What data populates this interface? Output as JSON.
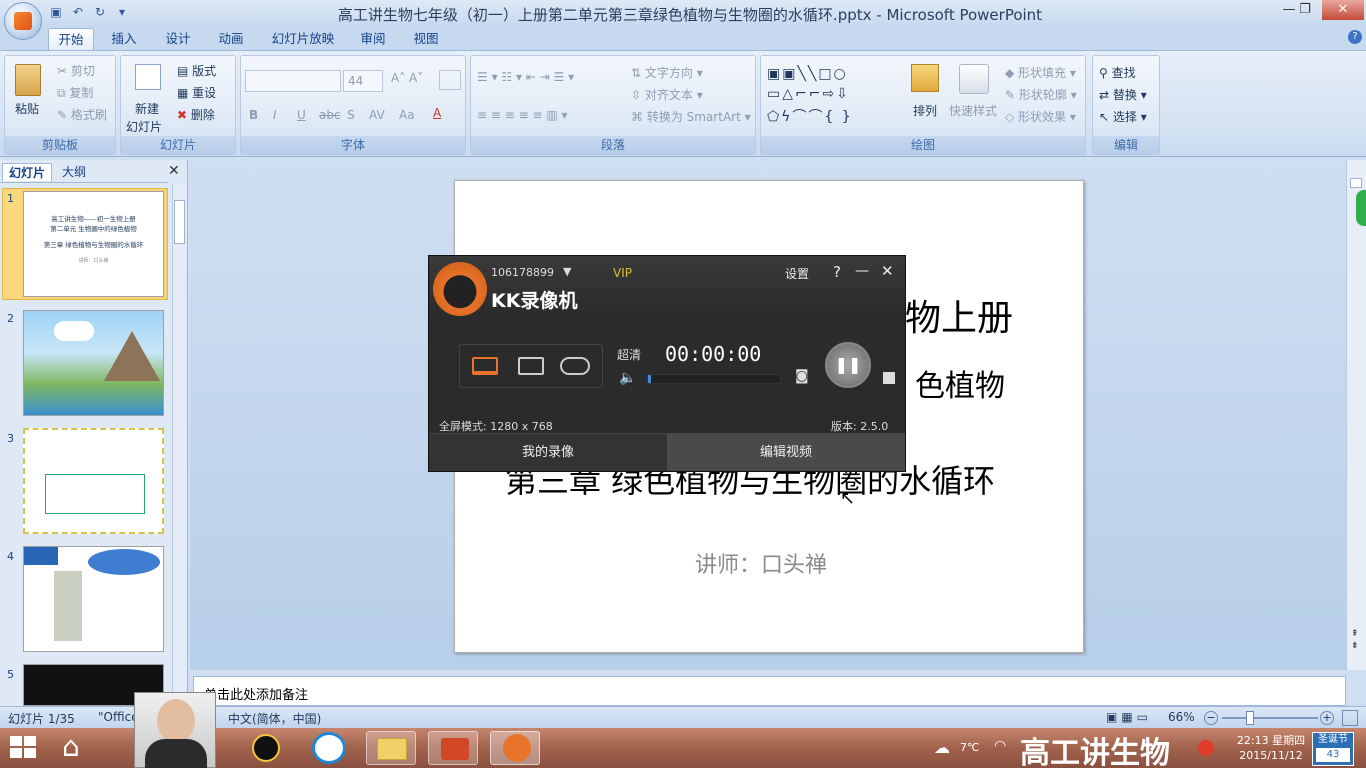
{
  "window": {
    "title": "高工讲生物七年级（初一）上册第二单元第三章绿色植物与生物圈的水循环.pptx - Microsoft PowerPoint",
    "minimize": "—",
    "restore": "❐",
    "close": "✕"
  },
  "ribbon": {
    "tabs": [
      "开始",
      "插入",
      "设计",
      "动画",
      "幻灯片放映",
      "审阅",
      "视图"
    ],
    "clipboard": {
      "paste": "粘贴",
      "cut": "剪切",
      "copy": "复制",
      "format_painter": "格式刷",
      "label": "剪贴板"
    },
    "slides": {
      "new_slide_1": "新建",
      "new_slide_2": "幻灯片",
      "layout": "版式",
      "reset": "重设",
      "delete": "删除",
      "label": "幻灯片"
    },
    "font": {
      "font_size": "44",
      "label": "字体",
      "bold": "B",
      "italic": "I",
      "underline": "U",
      "strike": "abc",
      "shadow": "S",
      "spacing": "AV",
      "case": "Aa",
      "color": "A"
    },
    "paragraph": {
      "text_direction": "文字方向",
      "align_text": "对齐文本",
      "smartart": "转换为 SmartArt",
      "label": "段落"
    },
    "drawing": {
      "arrange": "排列",
      "quick_styles": "快速样式",
      "shape_fill": "形状填充",
      "shape_outline": "形状轮廓",
      "shape_effects": "形状效果",
      "label": "绘图"
    },
    "editing": {
      "find": "查找",
      "replace": "替换",
      "select": "选择",
      "label": "编辑"
    }
  },
  "left_pane": {
    "tab_slides": "幻灯片",
    "tab_outline": "大纲",
    "thumbnails": [
      {
        "num": "1",
        "lines": [
          "高工讲生物——初一生物上册",
          "第二单元  生物圈中的绿色植物",
          "第三章 绿色植物与生物圈的水循环",
          "讲师：口头禅"
        ]
      },
      {
        "num": "2"
      },
      {
        "num": "3"
      },
      {
        "num": "4"
      },
      {
        "num": "5"
      }
    ]
  },
  "slide": {
    "line1": "物上册",
    "line2": "色植物",
    "line3": "第三章 绿色植物与生物圈的水循环",
    "line4": "讲师：口头禅"
  },
  "notes_placeholder": "单击此处添加备注",
  "status": {
    "slide_count": "幻灯片 1/35",
    "theme": "\"Office",
    "language": "中文(简体，中国)",
    "zoom": "66%"
  },
  "kk_recorder": {
    "account": "106178899",
    "vip": "VIP",
    "settings": "设置",
    "help": "?",
    "minimize": "—",
    "close": "✕",
    "app_name": "KK录像机",
    "quality": "超清",
    "timer": "00:00:00",
    "mode": "全屏模式: 1280 x 768",
    "version": "版本: 2.5.0",
    "my_recordings": "我的录像",
    "edit_video": "编辑视频"
  },
  "taskbar": {
    "weather": "7℃",
    "time": "22:13 星期四",
    "date": "2015/11/12",
    "watermark": "高工讲生物",
    "holiday": "圣诞节",
    "holiday_days": "43"
  },
  "colors": {
    "accent": "#15428b",
    "ribbon_bg": "#d5e3f3",
    "kk_bg": "#2b2b2b",
    "taskbar": "#a1624c",
    "kk_orange": "#e8732a"
  }
}
